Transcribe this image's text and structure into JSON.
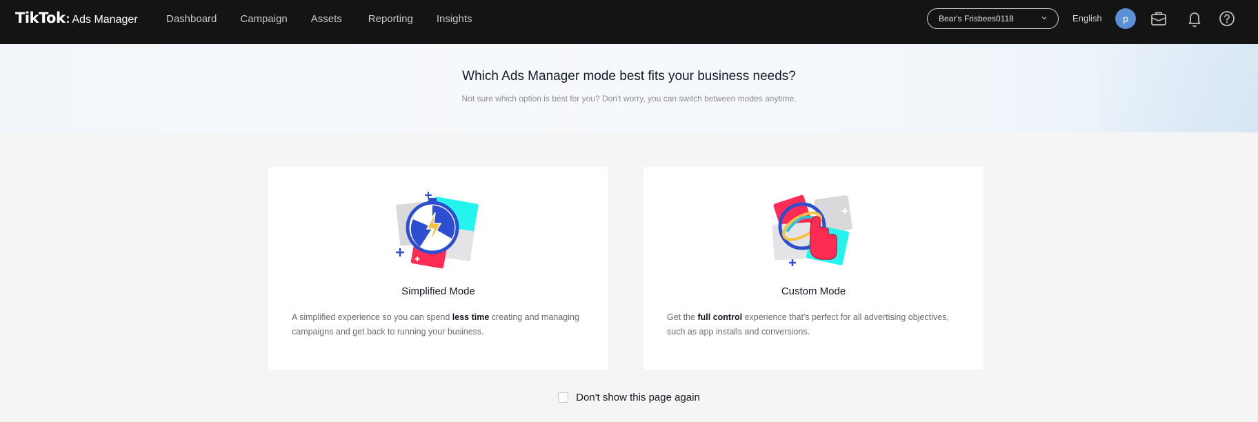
{
  "brand": {
    "logo_main": "TikTok",
    "logo_sep": ":",
    "logo_product": "Ads Manager"
  },
  "nav": {
    "items": [
      {
        "label": "Dashboard"
      },
      {
        "label": "Campaign"
      },
      {
        "label": "Assets"
      },
      {
        "label": "Reporting"
      },
      {
        "label": "Insights"
      }
    ]
  },
  "header": {
    "account_select": "Bear's Frisbees0118",
    "language": "English",
    "avatar_letter": "p",
    "icons": [
      "briefcase-icon",
      "bell-icon",
      "help-icon"
    ]
  },
  "hero": {
    "title": "Which Ads Manager mode best fits your business needs?",
    "subtitle": "Not sure which option is best for you? Don't worry, you can switch between modes anytime."
  },
  "modes": [
    {
      "title": "Simplified Mode",
      "desc_before": "A simplified experience so you can spend ",
      "desc_bold": "less time",
      "desc_after": " creating and managing campaigns and get back to running your business."
    },
    {
      "title": "Custom Mode",
      "desc_before": "Get the ",
      "desc_bold": "full control",
      "desc_after": " experience that's perfect for all advertising objectives, such as app installs and conversions."
    }
  ],
  "footer": {
    "dont_show_label": "Don't show this page again",
    "dont_show_checked": false
  },
  "colors": {
    "topbar": "#141414",
    "accent_red": "#fe2c55",
    "accent_cyan": "#25f4ee",
    "accent_blue": "#2d4ecf",
    "avatar": "#5b8fd6"
  }
}
